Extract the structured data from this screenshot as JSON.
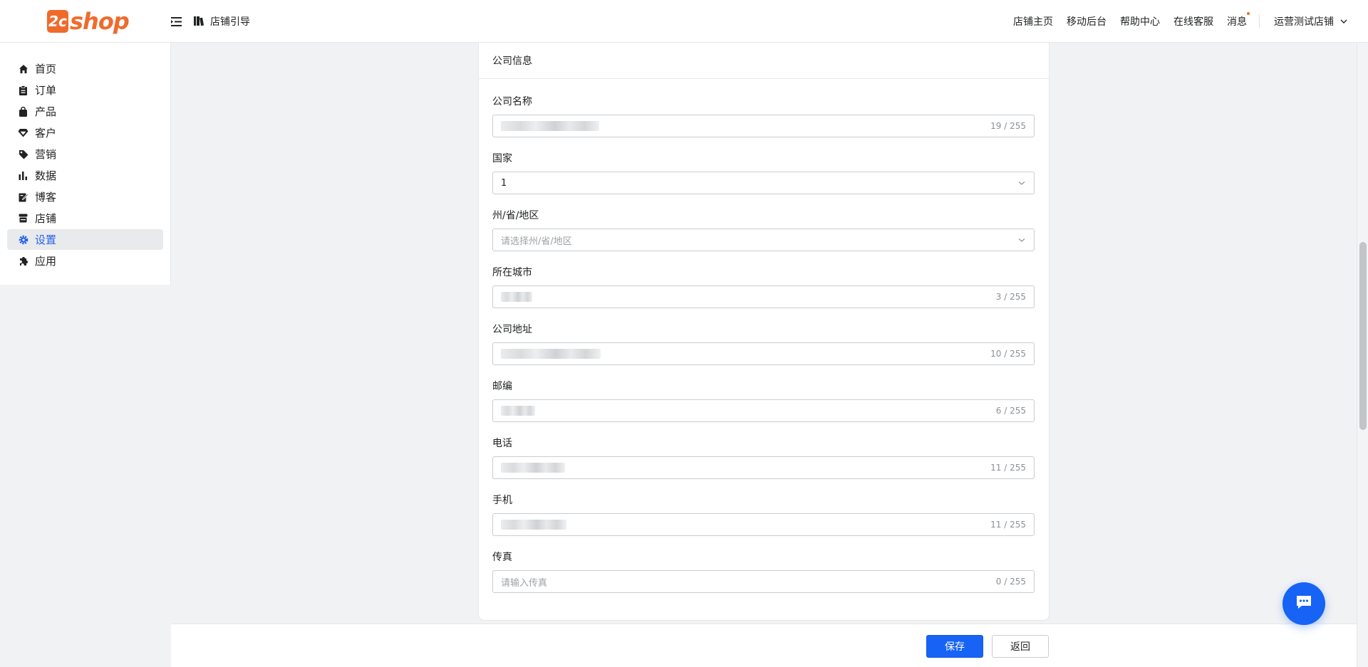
{
  "brand": {
    "logo_mark": "2c",
    "logo_text": "shop",
    "color": "#ef6b2c"
  },
  "header": {
    "guide_label": "店铺引导",
    "links": [
      "店铺主页",
      "移动后台",
      "帮助中心",
      "在线客服"
    ],
    "message_label": "消息",
    "store_name": "运营测试店铺"
  },
  "sidebar": {
    "items": [
      {
        "label": "首页",
        "icon": "home-icon"
      },
      {
        "label": "订单",
        "icon": "clipboard-icon"
      },
      {
        "label": "产品",
        "icon": "bag-icon"
      },
      {
        "label": "客户",
        "icon": "diamond-icon"
      },
      {
        "label": "营销",
        "icon": "tag-icon"
      },
      {
        "label": "数据",
        "icon": "bar-chart-icon"
      },
      {
        "label": "博客",
        "icon": "edit-icon"
      },
      {
        "label": "店铺",
        "icon": "store-icon"
      },
      {
        "label": "设置",
        "icon": "gear-icon",
        "active": true
      },
      {
        "label": "应用",
        "icon": "puzzle-icon"
      }
    ]
  },
  "card": {
    "title": "公司信息",
    "fields": {
      "company_name": {
        "label": "公司名称",
        "counter": "19 / 255"
      },
      "country": {
        "label": "国家",
        "value": "1"
      },
      "state": {
        "label": "州/省/地区",
        "placeholder": "请选择州/省/地区"
      },
      "city": {
        "label": "所在城市",
        "counter": "3 / 255"
      },
      "address": {
        "label": "公司地址",
        "counter": "10 / 255"
      },
      "zip": {
        "label": "邮编",
        "counter": "6 / 255"
      },
      "phone": {
        "label": "电话",
        "counter": "11 / 255"
      },
      "mobile": {
        "label": "手机",
        "counter": "11 / 255"
      },
      "fax": {
        "label": "传真",
        "placeholder": "请输入传真",
        "counter": "0 / 255"
      }
    }
  },
  "footer": {
    "save_label": "保存",
    "back_label": "返回"
  },
  "colors": {
    "primary": "#1763f5",
    "active_text": "#2463eb",
    "notify_dot": "#f26b2b"
  }
}
